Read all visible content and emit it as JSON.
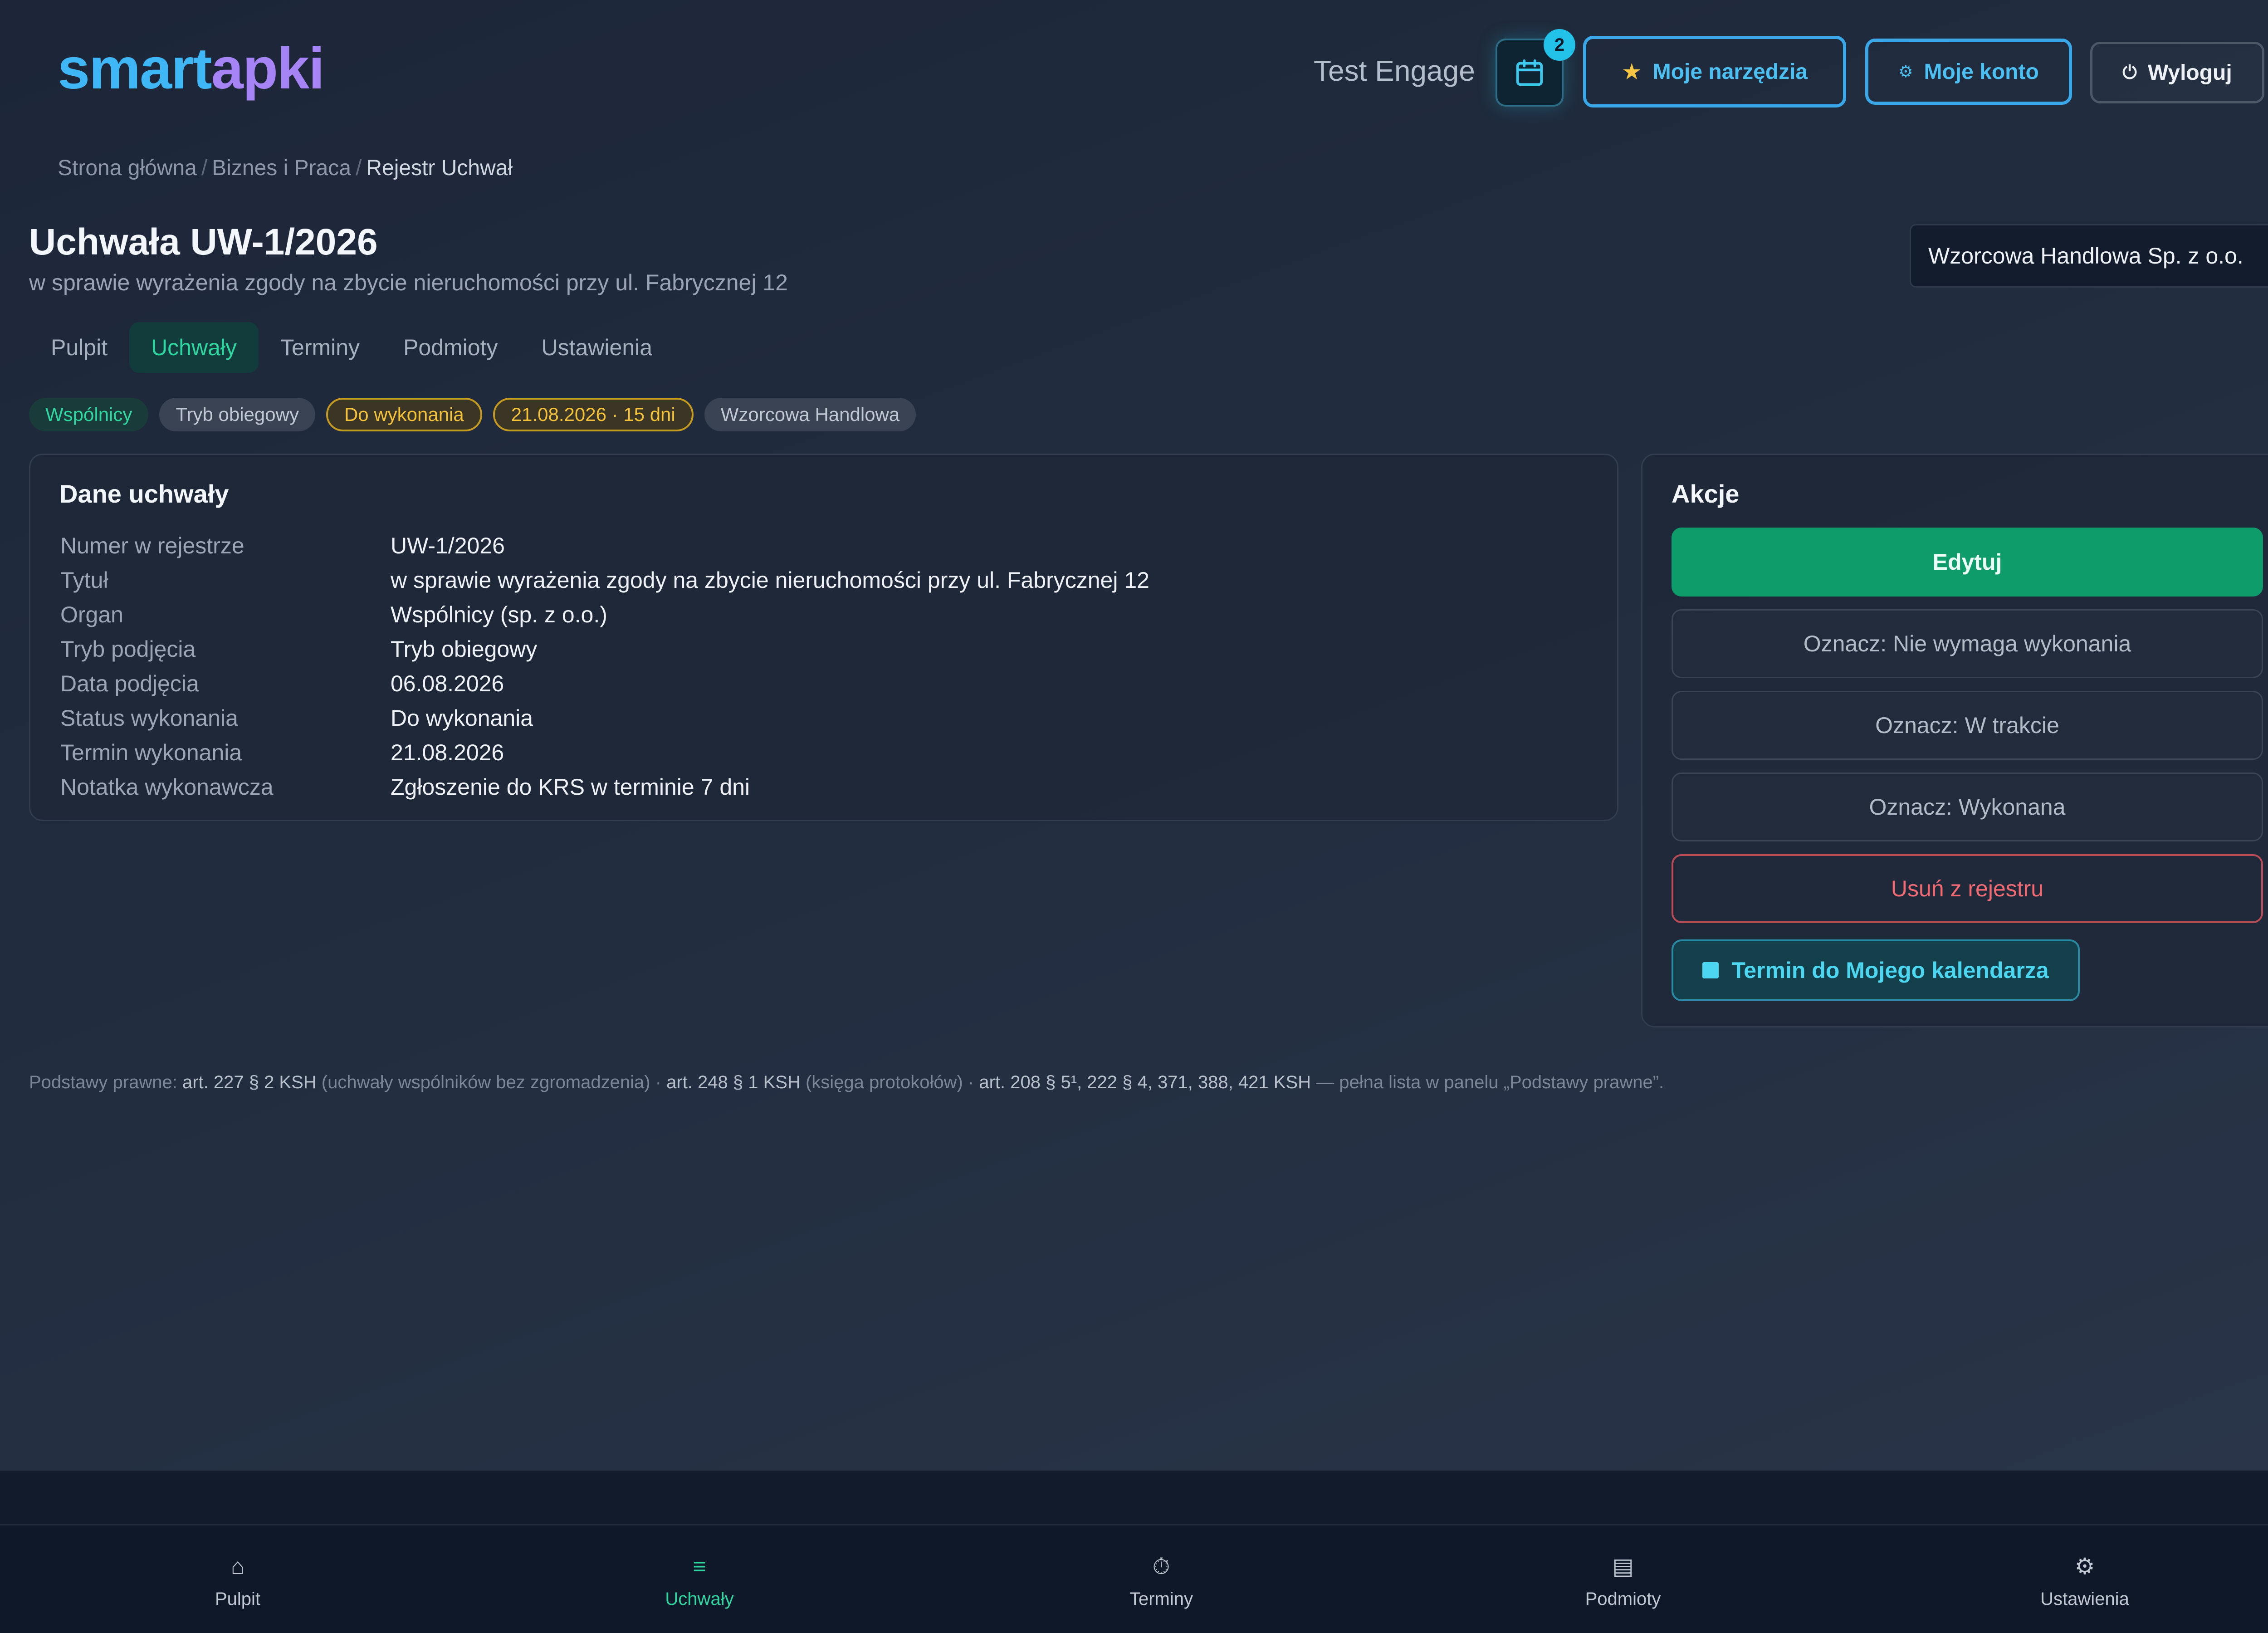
{
  "header": {
    "logo_part1": "smart",
    "logo_part2": "apki",
    "user_name": "Test Engage",
    "calendar_badge": "2",
    "tools_label": "Moje narzędzia",
    "account_label": "Moje konto",
    "logout_label": "Wyloguj",
    "star_icon": "★",
    "gear_icon": "⚙",
    "power_icon": "⏻"
  },
  "breadcrumb": {
    "items": [
      "Strona główna",
      "Biznes i Praca",
      "Rejestr Uchwał"
    ],
    "separator": "/"
  },
  "page": {
    "title": "Uchwała UW-1/2026",
    "subtitle": "w sprawie wyrażenia zgody na zbycie nieruchomości przy ul. Fabrycznej 12",
    "entity_selected": "Wzorcowa Handlowa Sp. z o.o."
  },
  "tabs": [
    "Pulpit",
    "Uchwały",
    "Terminy",
    "Podmioty",
    "Ustawienia"
  ],
  "chips": [
    "Wspólnicy",
    "Tryb obiegowy",
    "Do wykonania",
    "21.08.2026 · 15 dni",
    "Wzorcowa Handlowa"
  ],
  "details": {
    "title": "Dane uchwały",
    "rows": [
      {
        "k": "Numer w rejestrze",
        "v": "UW-1/2026"
      },
      {
        "k": "Tytuł",
        "v": "w sprawie wyrażenia zgody na zbycie nieruchomości przy ul. Fabrycznej 12"
      },
      {
        "k": "Organ",
        "v": "Wspólnicy (sp. z o.o.)"
      },
      {
        "k": "Tryb podjęcia",
        "v": "Tryb obiegowy"
      },
      {
        "k": "Data podjęcia",
        "v": "06.08.2026"
      },
      {
        "k": "Status wykonania",
        "v": "Do wykonania"
      },
      {
        "k": "Termin wykonania",
        "v": "21.08.2026"
      },
      {
        "k": "Notatka wykonawcza",
        "v": "Zgłoszenie do KRS w terminie 7 dni"
      }
    ]
  },
  "actions": {
    "title": "Akcje",
    "edit": "Edytuj",
    "mark_not_required": "Oznacz: Nie wymaga wykonania",
    "mark_in_progress": "Oznacz: W trakcie",
    "mark_done": "Oznacz: Wykonana",
    "delete": "Usuń z rejestru",
    "add_to_calendar": "Termin do Mojego kalendarza"
  },
  "legal": {
    "prefix": "Podstawy prawne: ",
    "a1": "art. 227 § 2 KSH",
    "n1": " (uchwały wspólników bez zgromadzenia) · ",
    "a2": "art. 248 § 1 KSH",
    "n2": " (księga protokołów) · ",
    "a3": "art. 208 § 5¹, 222 § 4, 371, 388, 421 KSH",
    "n3": " — pełna lista w panelu „Podstawy prawne”."
  },
  "bottom_nav": {
    "items": [
      {
        "label": "Pulpit",
        "icon": "⌂"
      },
      {
        "label": "Uchwały",
        "icon": "≡"
      },
      {
        "label": "Terminy",
        "icon": "⏱"
      },
      {
        "label": "Podmioty",
        "icon": "▤"
      },
      {
        "label": "Ustawienia",
        "icon": "⚙"
      }
    ]
  },
  "colors": {
    "accent_green": "#2fd6a0",
    "accent_cyan": "#3aa8e8",
    "danger": "#f36a72",
    "warning": "#f3c23a"
  }
}
